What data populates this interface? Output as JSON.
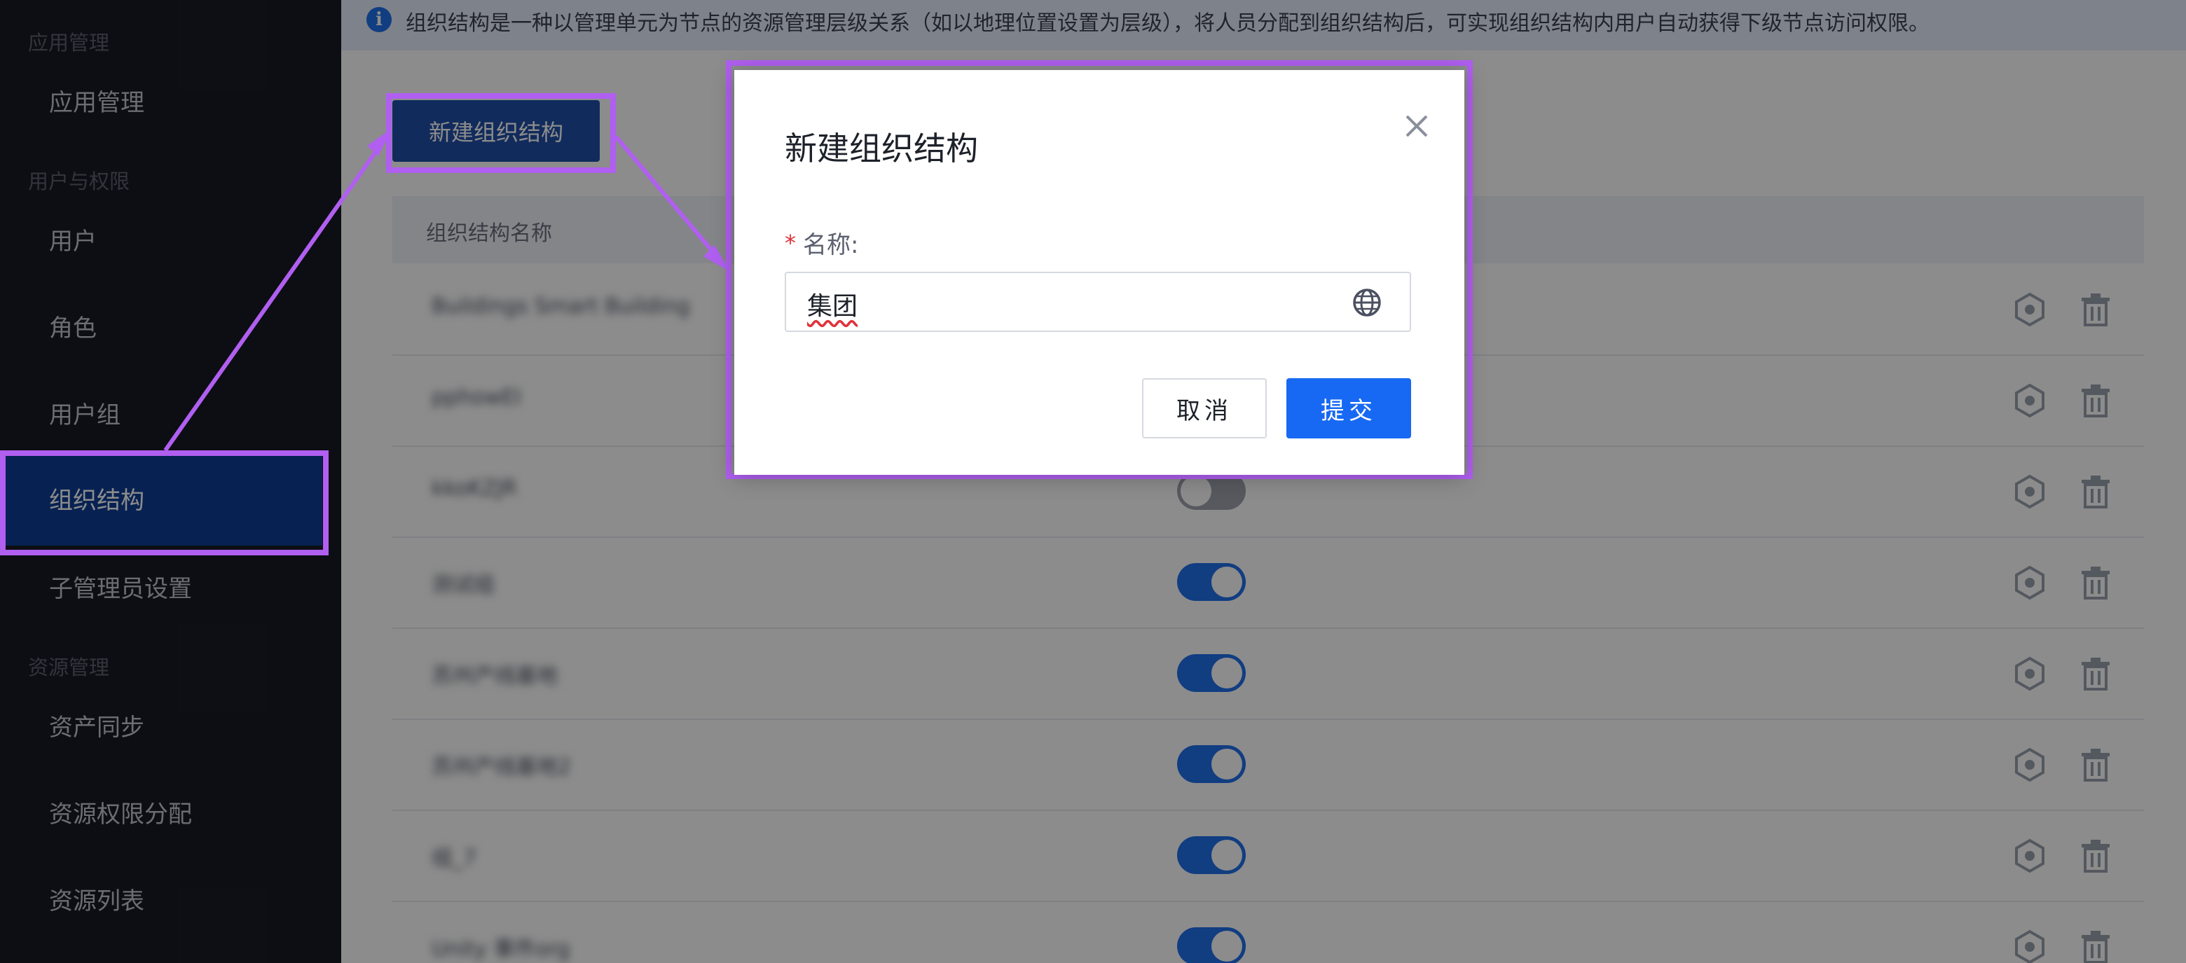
{
  "sidebar": {
    "groups": [
      {
        "label": "应用管理"
      },
      {
        "label": "用户与权限"
      },
      {
        "label": "资源管理"
      }
    ],
    "items": [
      {
        "label": "应用管理"
      },
      {
        "label": "用户"
      },
      {
        "label": "角色"
      },
      {
        "label": "用户组"
      },
      {
        "label": "组织结构",
        "active": true
      },
      {
        "label": "子管理员设置"
      },
      {
        "label": "资产同步"
      },
      {
        "label": "资源权限分配"
      },
      {
        "label": "资源列表"
      }
    ]
  },
  "info_bar": {
    "icon": "info-icon",
    "text": "组织结构是一种以管理单元为节点的资源管理层级关系（如以地理位置设置为层级），将人员分配到组织结构后，可实现组织结构内用户自动获得下级节点访问权限。"
  },
  "toolbar": {
    "new_button_label": "新建组织结构"
  },
  "table": {
    "column_name": "组织结构名称",
    "rows": [
      {
        "name": "Buildings Smart Building",
        "enabled": null
      },
      {
        "name": "pphowEI",
        "enabled": null
      },
      {
        "name": "kkoKZJR",
        "enabled": false
      },
      {
        "name": "测试组",
        "enabled": true
      },
      {
        "name": "苏州产线基地",
        "enabled": true
      },
      {
        "name": "苏州产线基地2",
        "enabled": true
      },
      {
        "name": "组_7",
        "enabled": true
      },
      {
        "name": "Unity 事件org",
        "enabled": true
      }
    ],
    "row_actions": [
      "settings-icon",
      "delete-icon"
    ]
  },
  "modal": {
    "title": "新建组织结构",
    "required_mark": "*",
    "field_label": "名称:",
    "field_value": "集团",
    "field_icon": "globe-icon",
    "cancel_label": "取消",
    "submit_label": "提交",
    "close_icon": "close-icon"
  },
  "colors": {
    "sidebar_bg": "#191b24",
    "active_item": "#0d3f96",
    "primary": "#1769f3",
    "highlight": "#b05ff0",
    "required": "#e0323c"
  }
}
